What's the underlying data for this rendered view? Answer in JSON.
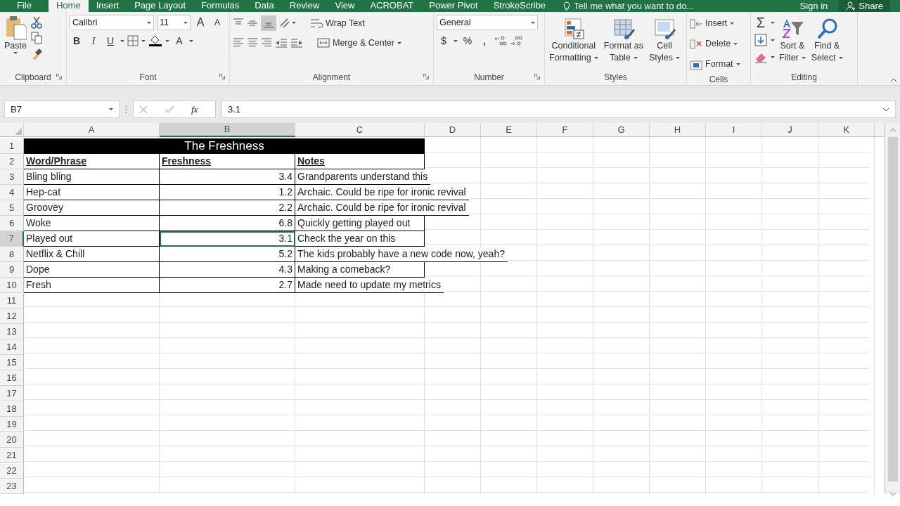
{
  "menu_tabs": [
    {
      "label": "File",
      "selected": false
    },
    {
      "label": "Home",
      "selected": true
    },
    {
      "label": "Insert",
      "selected": false
    },
    {
      "label": "Page Layout",
      "selected": false
    },
    {
      "label": "Formulas",
      "selected": false
    },
    {
      "label": "Data",
      "selected": false
    },
    {
      "label": "Review",
      "selected": false
    },
    {
      "label": "View",
      "selected": false
    },
    {
      "label": "ACROBAT",
      "selected": false
    },
    {
      "label": "Power Pivot",
      "selected": false
    },
    {
      "label": "StrokeScribe",
      "selected": false
    }
  ],
  "tell_me": "Tell me what you want to do...",
  "sign_in": "Sign in",
  "share": "Share",
  "ribbon_groups": [
    {
      "kind": "clipboard",
      "label": "Clipboard",
      "paste": "Paste"
    },
    {
      "kind": "font",
      "label": "Font",
      "font": "Calibri",
      "size": "11",
      "grow": "A",
      "shrink": "A",
      "bold": "B",
      "italic": "I",
      "underline": "U",
      "font_color": "A"
    },
    {
      "kind": "alignment",
      "label": "Alignment",
      "wrap": "Wrap Text",
      "merge": "Merge & Center"
    },
    {
      "kind": "number",
      "label": "Number",
      "format": "General",
      "currency": "$",
      "percent": "%",
      "comma": ","
    },
    {
      "kind": "styles",
      "label": "Styles",
      "buttons": [
        [
          "Conditional",
          "Formatting"
        ],
        [
          "Format as",
          "Table"
        ],
        [
          "Cell",
          "Styles"
        ]
      ]
    },
    {
      "kind": "cells",
      "label": "Cells",
      "buttons": [
        "Insert",
        "Delete",
        "Format"
      ]
    },
    {
      "kind": "editing",
      "label": "Editing",
      "sum": "Σ",
      "buttons": [
        [
          "Sort &",
          "Filter"
        ],
        [
          "Find &",
          "Select"
        ]
      ]
    }
  ],
  "formula_bar": {
    "name_box": "B7",
    "fx": "fx",
    "formula": "3.1"
  },
  "columns": [
    {
      "label": "A",
      "selected": false
    },
    {
      "label": "B",
      "selected": true
    },
    {
      "label": "C",
      "selected": false
    },
    {
      "label": "D",
      "selected": false
    },
    {
      "label": "E",
      "selected": false
    },
    {
      "label": "F",
      "selected": false
    },
    {
      "label": "G",
      "selected": false
    },
    {
      "label": "H",
      "selected": false
    },
    {
      "label": "I",
      "selected": false
    },
    {
      "label": "J",
      "selected": false
    },
    {
      "label": "K",
      "selected": false
    }
  ],
  "rows": [
    {
      "label": "1",
      "selected": false
    },
    {
      "label": "2",
      "selected": false
    },
    {
      "label": "3",
      "selected": false
    },
    {
      "label": "4",
      "selected": false
    },
    {
      "label": "5",
      "selected": false
    },
    {
      "label": "6",
      "selected": false
    },
    {
      "label": "7",
      "selected": true
    },
    {
      "label": "8",
      "selected": false
    },
    {
      "label": "9",
      "selected": false
    },
    {
      "label": "10",
      "selected": false
    },
    {
      "label": "11",
      "selected": false
    },
    {
      "label": "12",
      "selected": false
    },
    {
      "label": "13",
      "selected": false
    },
    {
      "label": "14",
      "selected": false
    },
    {
      "label": "15",
      "selected": false
    },
    {
      "label": "16",
      "selected": false
    },
    {
      "label": "17",
      "selected": false
    },
    {
      "label": "18",
      "selected": false
    },
    {
      "label": "19",
      "selected": false
    },
    {
      "label": "20",
      "selected": false
    },
    {
      "label": "21",
      "selected": false
    },
    {
      "label": "22",
      "selected": false
    },
    {
      "label": "23",
      "selected": false
    }
  ],
  "sheet_title": "The Freshness",
  "table_header": [
    "Word/Phrase",
    "Freshness",
    "Notes"
  ],
  "table_rows": [
    {
      "cells": [
        "Bling bling",
        "3.4",
        "Grandparents understand this"
      ],
      "selected": false
    },
    {
      "cells": [
        "Hep-cat",
        "1.2",
        "Archaic.  Could be ripe for ironic revival"
      ],
      "selected": false
    },
    {
      "cells": [
        "Groovey",
        "2.2",
        "Archaic.  Could be ripe for ironic revival"
      ],
      "selected": false
    },
    {
      "cells": [
        "Woke",
        "6.8",
        "Quickly getting played out"
      ],
      "selected": false
    },
    {
      "cells": [
        "Played out",
        "3.1",
        "Check the year on this"
      ],
      "selected": true
    },
    {
      "cells": [
        "Netflix & Chill",
        "5.2",
        "The kids probably have a new code now, yeah?"
      ],
      "selected": false
    },
    {
      "cells": [
        "Dope",
        "4.3",
        "Making a comeback?"
      ],
      "selected": false
    },
    {
      "cells": [
        "Fresh",
        "2.7",
        "Made need to update my metrics"
      ],
      "selected": false
    }
  ]
}
